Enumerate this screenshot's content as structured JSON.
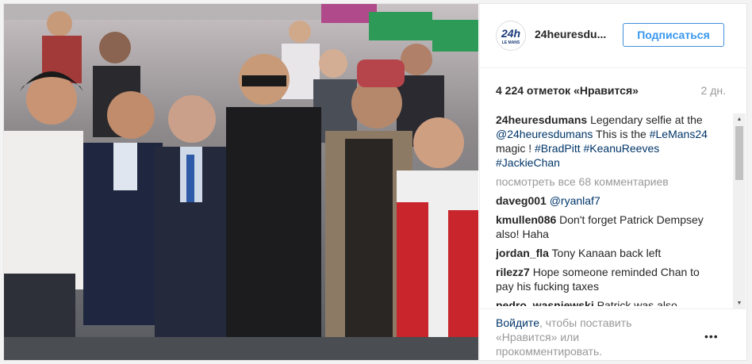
{
  "post": {
    "username": "24heuresdu...",
    "follow_label": "Подписаться",
    "likes": "4 224 отметок «Нравится»",
    "age": "2 дн.",
    "logo_text": "24h",
    "logo_sub": "LE MANS"
  },
  "caption": {
    "author": "24heuresdumans",
    "text_1": "Legendary selfie at the ",
    "mention": "@24heuresdumans",
    "text_2": " This is the ",
    "tag_1": "#LeMans24",
    "text_3": " magic ! ",
    "tag_2": "#BradPitt",
    "tag_3": "#KeanuReeves",
    "tag_4": "#JackieChan"
  },
  "view_all": "посмотреть все 68 комментариев",
  "comments": [
    {
      "author": "daveg001",
      "text": "@ryanlaf7"
    },
    {
      "author": "kmullen086",
      "text": "Don't forget Patrick Dempsey also! Haha"
    },
    {
      "author": "jordan_fla",
      "text": "Tony Kanaan back left"
    },
    {
      "author": "rilezz7",
      "text": "Hope someone reminded Chan to pay his fucking taxes"
    },
    {
      "author": "pedro_wasniewski",
      "text": "Patrick was also"
    }
  ],
  "footer": {
    "login_link": "Войдите",
    "login_rest": ", чтобы поставить «Нравится» или прокомментировать.",
    "more_icon": "•••"
  },
  "photo": {
    "description_colors": {
      "track": "#6d737a",
      "background_crowd": "#8a5a6a"
    }
  }
}
